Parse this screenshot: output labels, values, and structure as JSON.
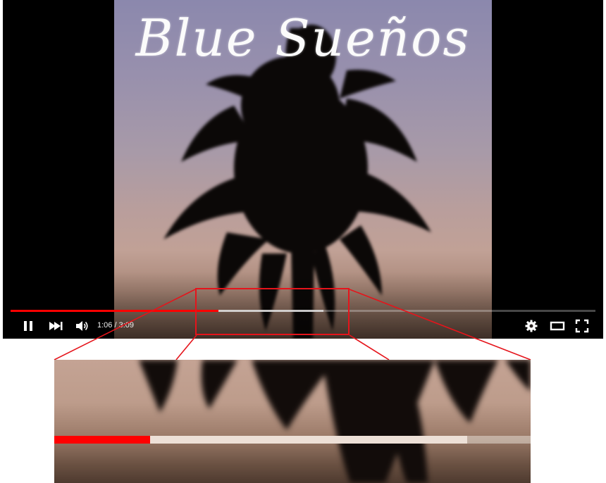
{
  "video": {
    "title": "Blue Sueños",
    "played_fraction": 0.355,
    "buffered_fraction": 0.535
  },
  "controls": {
    "current_time": "1:06",
    "separator": " / ",
    "duration": "3:09",
    "icons": [
      "pause-icon",
      "next-icon",
      "volume-icon",
      "settings-icon",
      "theater-mode-icon",
      "fullscreen-icon"
    ]
  },
  "zoom": {
    "played_fraction": 0.2,
    "buffered_fraction": 0.867
  },
  "colors": {
    "progress_played": "#ff0000",
    "progress_buffered": "#dcdcdc",
    "highlight_box": "#e5141b"
  }
}
